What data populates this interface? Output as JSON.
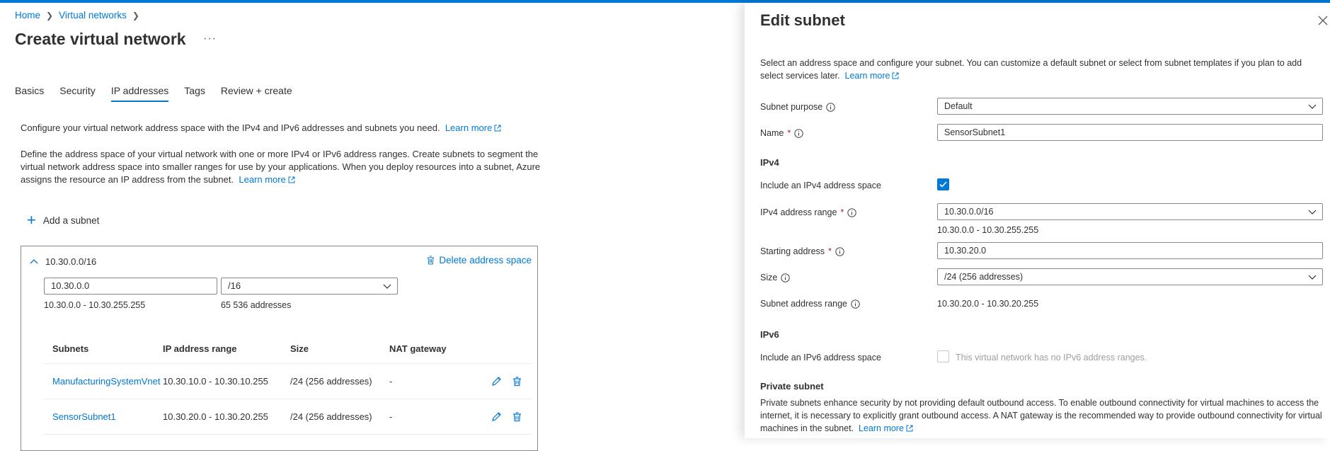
{
  "breadcrumb": {
    "home": "Home",
    "virtual_networks": "Virtual networks"
  },
  "page": {
    "title": "Create virtual network",
    "more": "···"
  },
  "tabs": [
    {
      "label": "Basics"
    },
    {
      "label": "Security"
    },
    {
      "label": "IP addresses",
      "active": true
    },
    {
      "label": "Tags"
    },
    {
      "label": "Review + create"
    }
  ],
  "intro": {
    "line1": "Configure your virtual network address space with the IPv4 and IPv6 addresses and subnets you need.",
    "line2": "Define the address space of your virtual network with one or more IPv4 or IPv6 address ranges. Create subnets to segment the virtual network address space into smaller ranges for use by your applications. When you deploy resources into a subnet, Azure assigns the resource an IP address from the subnet.",
    "learn_more": "Learn more"
  },
  "add_subnet_label": "Add a subnet",
  "address_space": {
    "header": "10.30.0.0/16",
    "delete_label": "Delete address space",
    "address_value": "10.30.0.0",
    "prefix_value": "/16",
    "range": "10.30.0.0 - 10.30.255.255",
    "count": "65 536 addresses"
  },
  "subnet_table": {
    "headers": [
      "Subnets",
      "IP address range",
      "Size",
      "NAT gateway"
    ],
    "rows": [
      {
        "name": "ManufacturingSystemVnet",
        "range": "10.30.10.0 - 10.30.10.255",
        "size": "/24 (256 addresses)",
        "nat": "-"
      },
      {
        "name": "SensorSubnet1",
        "range": "10.30.20.0 - 10.30.20.255",
        "size": "/24 (256 addresses)",
        "nat": "-"
      }
    ]
  },
  "panel": {
    "title": "Edit subnet",
    "description": "Select an address space and configure your subnet. You can customize a default subnet or select from subnet templates if you plan to add select services later.",
    "learn_more": "Learn more",
    "subnet_purpose_label": "Subnet purpose",
    "subnet_purpose_value": "Default",
    "name_label": "Name",
    "name_value": "SensorSubnet1",
    "ipv4_section": "IPv4",
    "include_ipv4_label": "Include an IPv4 address space",
    "include_ipv4_checked": true,
    "ipv4_range_label": "IPv4 address range",
    "ipv4_range_value": "10.30.0.0/16",
    "ipv4_range_hint": "10.30.0.0 - 10.30.255.255",
    "starting_address_label": "Starting address",
    "starting_address_value": "10.30.20.0",
    "size_label": "Size",
    "size_value": "/24 (256 addresses)",
    "subnet_range_label": "Subnet address range",
    "subnet_range_value": "10.30.20.0 - 10.30.20.255",
    "ipv6_section": "IPv6",
    "include_ipv6_label": "Include an IPv6 address space",
    "include_ipv6_checked": false,
    "ipv6_disabled_text": "This virtual network has no IPv6 address ranges.",
    "private_section": "Private subnet",
    "private_description": "Private subnets enhance security by not providing default outbound access. To enable outbound connectivity for virtual machines to access the internet, it is necessary to explicitly grant outbound access. A NAT gateway is the recommended way to provide outbound connectivity for virtual machines in the subnet.",
    "private_learn_more": "Learn more"
  },
  "colors": {
    "accent": "#0078d4",
    "required": "#a4262c",
    "border": "#8a8886"
  }
}
